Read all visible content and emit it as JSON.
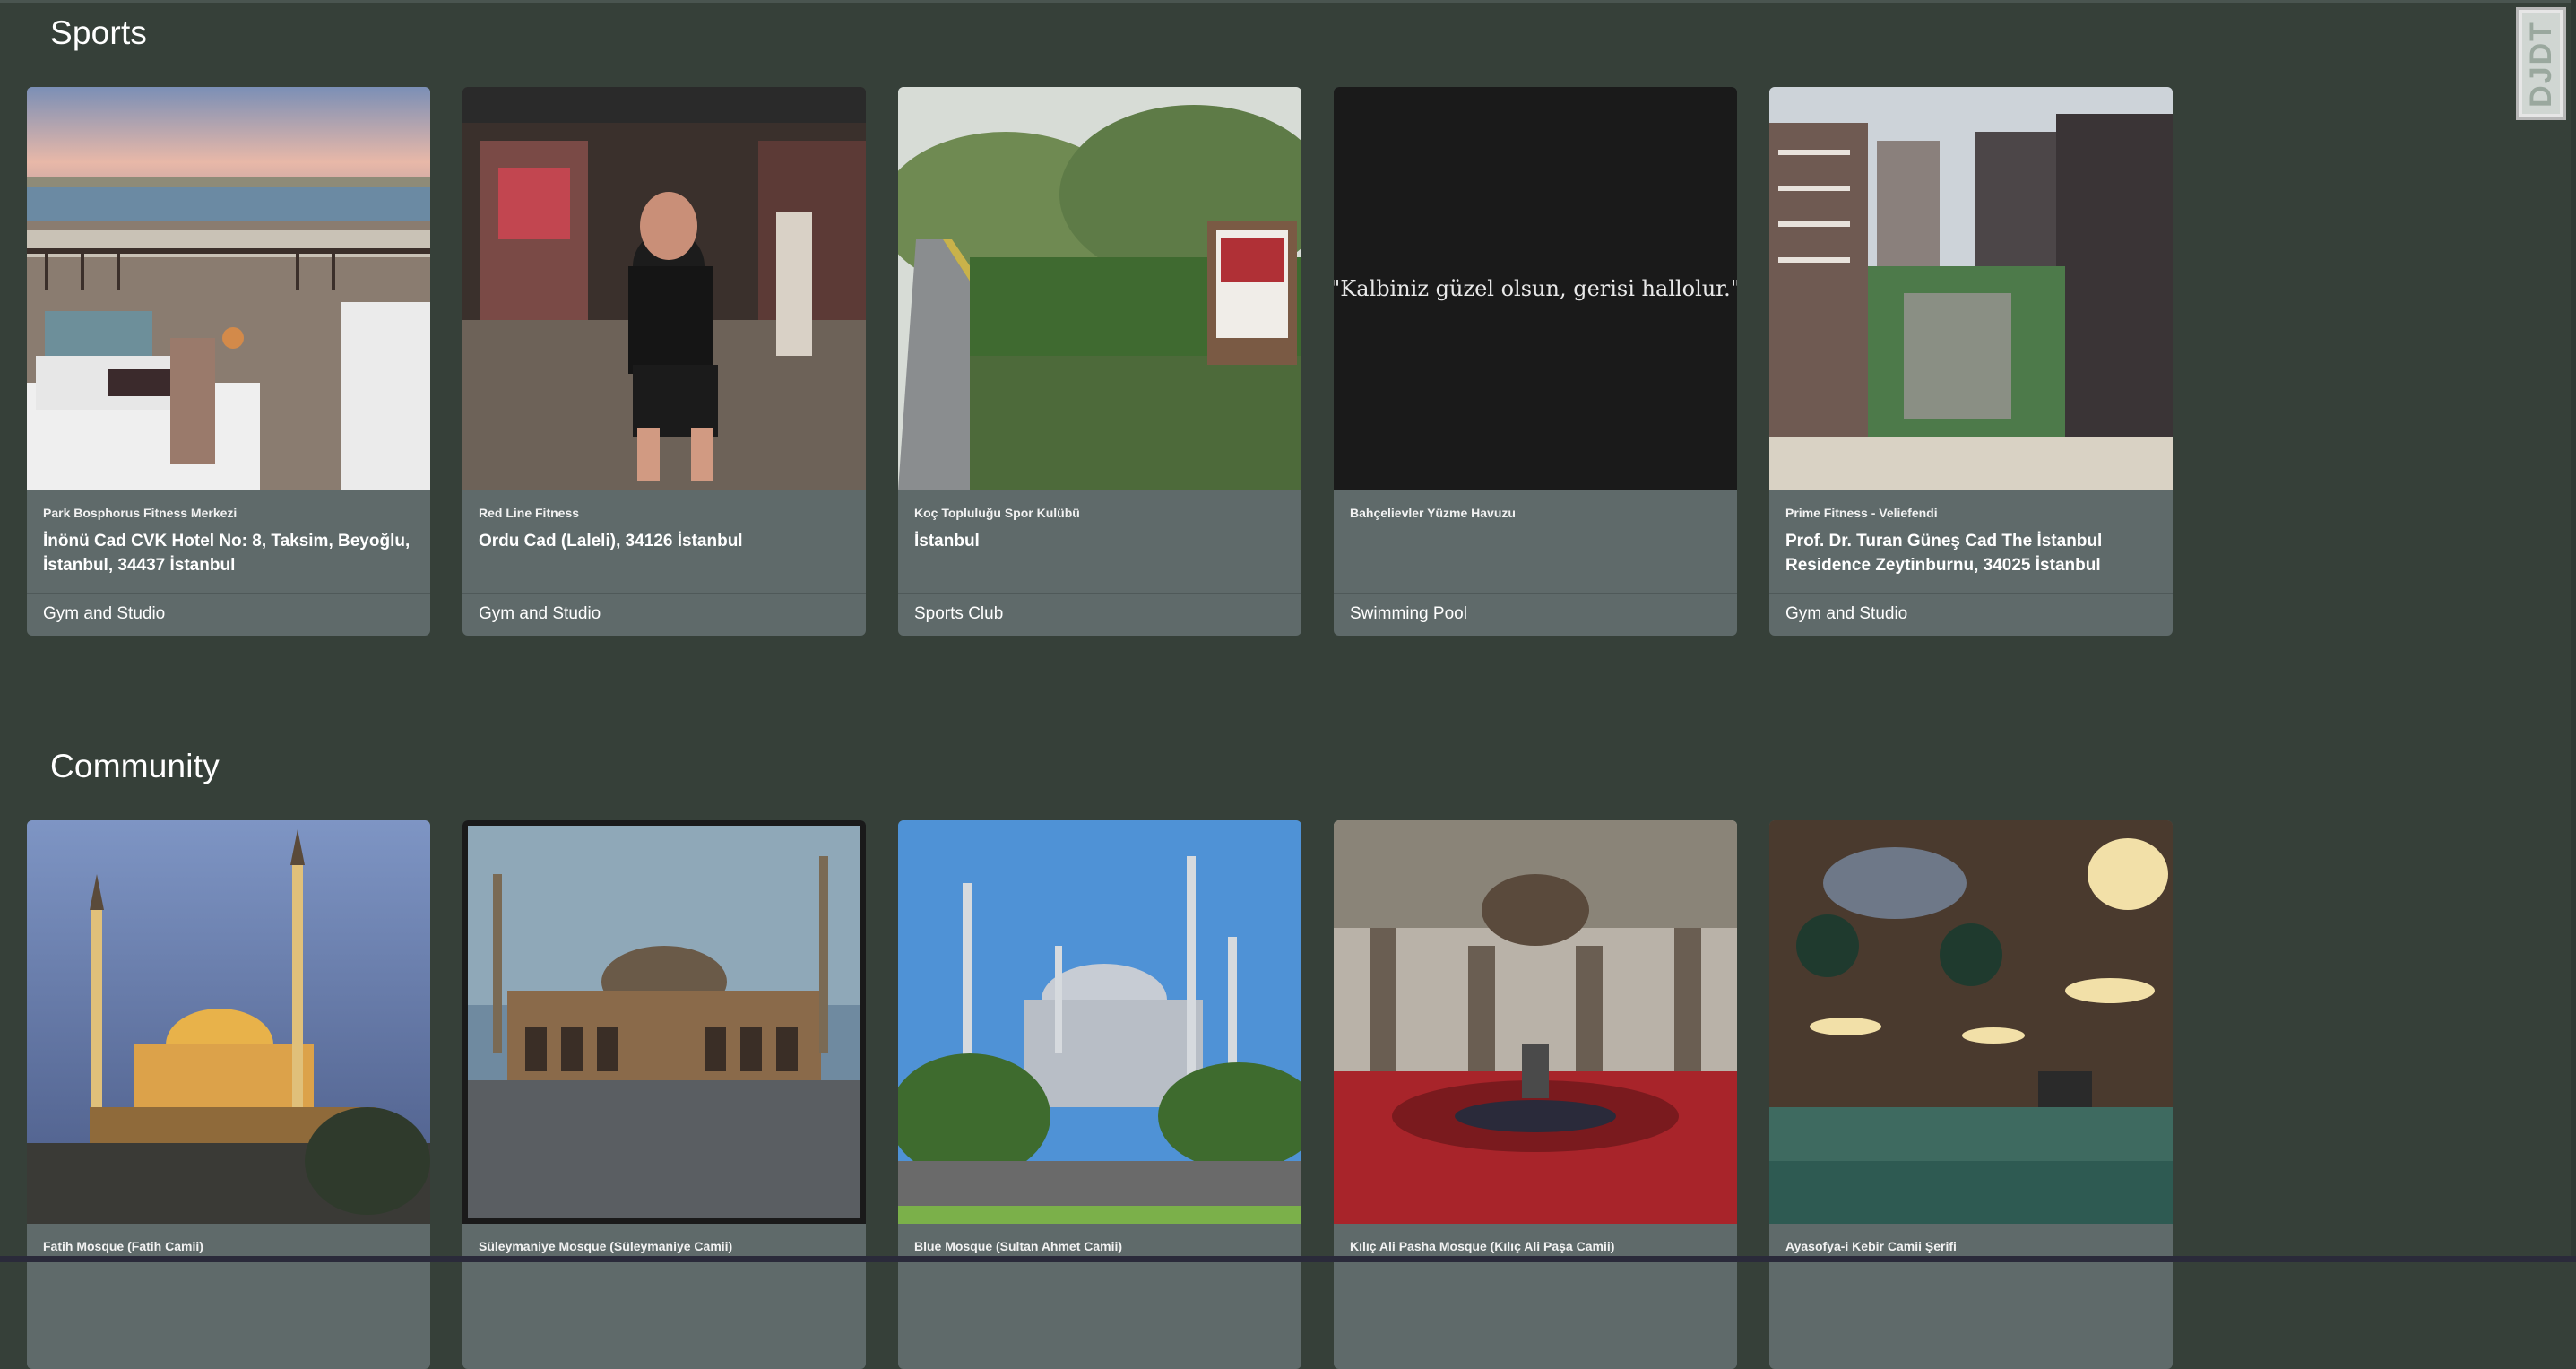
{
  "logo": {
    "text": "DJDT"
  },
  "sections": {
    "sports": {
      "title": "Sports",
      "cards": [
        {
          "venue": "Park Bosphorus Fitness Merkezi",
          "address": "İnönü Cad CVK Hotel No: 8, Taksim, Beyoğlu, İstanbul, 34437 İstanbul",
          "category": "Gym and Studio",
          "image": "terrace-bosphorus-view"
        },
        {
          "venue": "Red Line Fitness",
          "address": "Ordu Cad (Laleli), 34126 İstanbul",
          "category": "Gym and Studio",
          "image": "man-in-gym"
        },
        {
          "venue": "Koç Topluluğu Spor Kulübü",
          "address": "İstanbul",
          "category": "Sports Club",
          "image": "club-entrance-path"
        },
        {
          "venue": "Bahçelievler Yüzme Havuzu",
          "address": "",
          "category": "Swimming Pool",
          "image": "quote-card",
          "quote": "\"Kalbiniz güzel olsun, gerisi hallolur.\""
        },
        {
          "venue": "Prime Fitness - Veliefendi",
          "address": "Prof. Dr. Turan Güneş Cad The İstanbul Residence Zeytinburnu, 34025 İstanbul",
          "category": "Gym and Studio",
          "image": "residence-towers"
        }
      ]
    },
    "community": {
      "title": "Community",
      "cards": [
        {
          "venue": "Fatih Mosque (Fatih Camii)",
          "image": "mosque-dusk"
        },
        {
          "venue": "Süleymaniye Mosque (Süleymaniye Camii)",
          "image": "mosque-courtyard"
        },
        {
          "venue": "Blue Mosque (Sultan Ahmet Camii)",
          "image": "mosque-blue-sky"
        },
        {
          "venue": "Kılıç Ali Pasha Mosque (Kılıç Ali Paşa Camii)",
          "image": "mosque-interior-red"
        },
        {
          "venue": "Ayasofya-i Kebir Camii Şerifi",
          "image": "mosque-interior-chandeliers"
        }
      ]
    }
  },
  "colors": {
    "background": "#364039",
    "card": "#5f6a6a",
    "text": "#ffffff"
  }
}
